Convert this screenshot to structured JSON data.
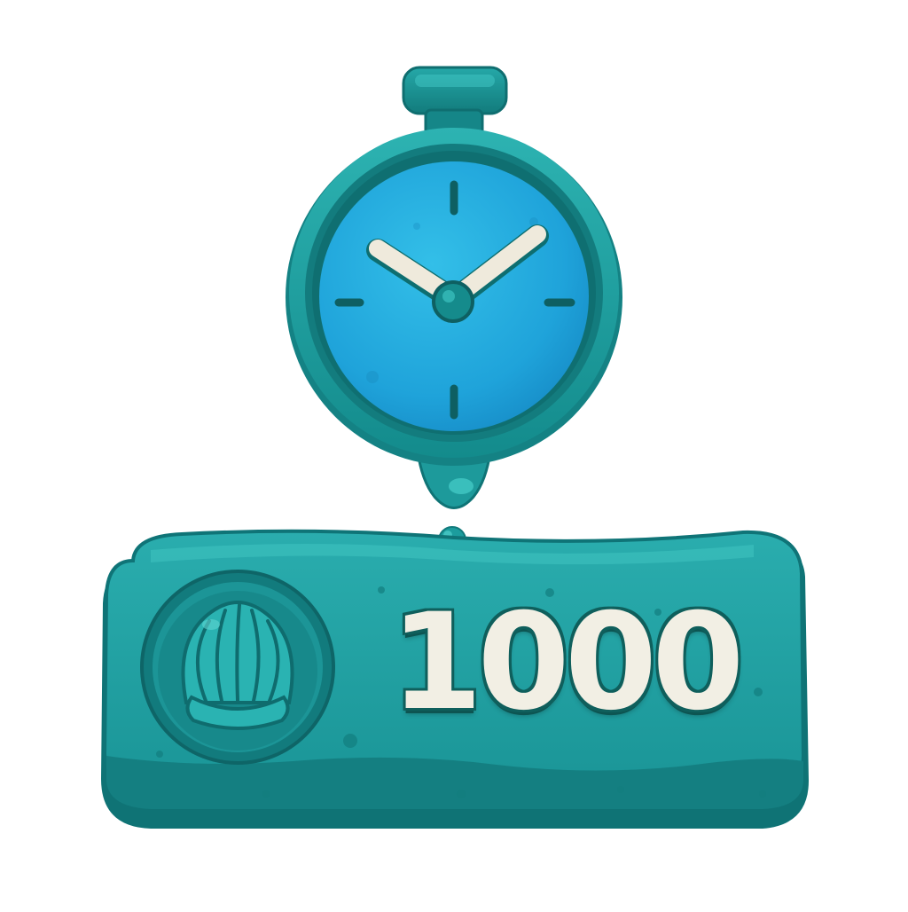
{
  "score": {
    "value": "1000",
    "currency_icon": "shell-icon"
  },
  "timer": {
    "icon": "stopwatch-icon"
  },
  "colors": {
    "teal_main": "#1f9ea0",
    "teal_dark": "#127a7c",
    "teal_deep": "#0d5f61",
    "teal_light": "#35c1c0",
    "clock_face": "#22a8dc",
    "clock_face_dark": "#1688c4",
    "hand_color": "#efeadc",
    "number_color": "#f2efe4"
  }
}
